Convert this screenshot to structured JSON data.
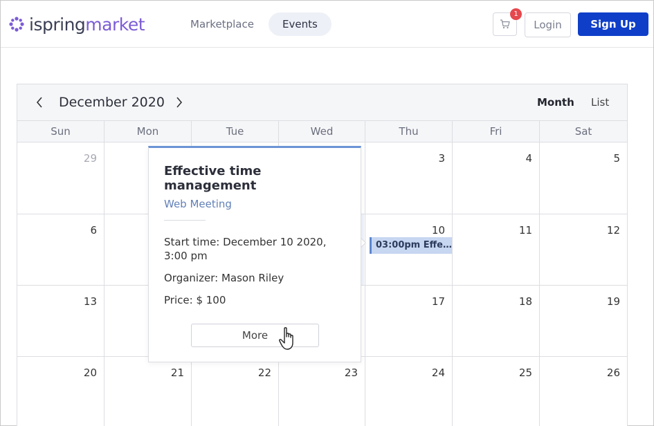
{
  "header": {
    "logo": {
      "part1": "ispring",
      "part2": "market"
    },
    "nav": [
      {
        "label": "Marketplace",
        "active": false
      },
      {
        "label": "Events",
        "active": true
      }
    ],
    "cart_count": "1",
    "login_label": "Login",
    "signup_label": "Sign Up"
  },
  "calendar": {
    "title": "December 2020",
    "views": {
      "month": "Month",
      "list": "List"
    },
    "weekdays": [
      "Sun",
      "Mon",
      "Tue",
      "Wed",
      "Thu",
      "Fri",
      "Sat"
    ],
    "weeks": [
      [
        "29",
        "",
        "",
        "",
        "3",
        "4",
        "5"
      ],
      [
        "6",
        "",
        "",
        "",
        "10",
        "11",
        "12"
      ],
      [
        "13",
        "",
        "",
        "",
        "17",
        "18",
        "19"
      ],
      [
        "20",
        "21",
        "22",
        "23",
        "24",
        "25",
        "26"
      ]
    ],
    "event_chip": "03:00pm Effe..."
  },
  "popover": {
    "title": "Effective time management",
    "type": "Web Meeting",
    "start_label": "Start time:",
    "start_value": "December 10 2020, 3:00 pm",
    "organizer_label": "Organizer:",
    "organizer_value": "Mason Riley",
    "price_label": "Price:",
    "price_value": "$ 100",
    "more_label": "More"
  },
  "colors": {
    "brand": "#7b5cd6",
    "primary": "#0f3fc9",
    "badge": "#e5484d",
    "event": "#c7d6f1",
    "event_accent": "#5b86cf"
  }
}
